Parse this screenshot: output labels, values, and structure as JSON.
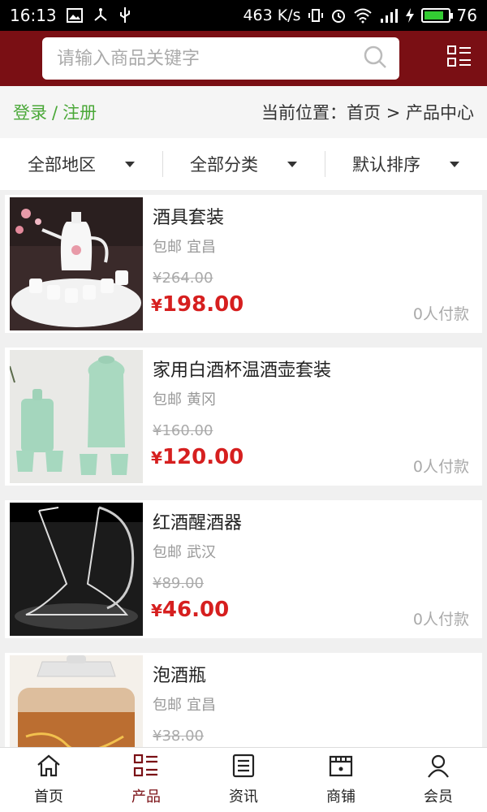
{
  "status_bar": {
    "time": "16:13",
    "net_speed": "463 K/s",
    "battery_level": "76"
  },
  "search": {
    "placeholder": "请输入商品关键字"
  },
  "breadcrumb": {
    "login": "登录",
    "separator": "/",
    "register": "注册",
    "location": "当前位置：首页 > 产品中心"
  },
  "filters": [
    {
      "label": "全部地区"
    },
    {
      "label": "全部分类"
    },
    {
      "label": "默认排序"
    }
  ],
  "products": [
    {
      "title": "酒具套装",
      "shipping": "包邮",
      "city": "宜昌",
      "orig_price": "¥264.00",
      "price": "198.00",
      "currency": "¥",
      "paid": "0人付款"
    },
    {
      "title": "家用白酒杯温酒壶套装",
      "shipping": "包邮",
      "city": "黄冈",
      "orig_price": "¥160.00",
      "price": "120.00",
      "currency": "¥",
      "paid": "0人付款"
    },
    {
      "title": "红酒醒酒器",
      "shipping": "包邮",
      "city": "武汉",
      "orig_price": "¥89.00",
      "price": "46.00",
      "currency": "¥",
      "paid": "0人付款"
    },
    {
      "title": "泡酒瓶",
      "shipping": "包邮",
      "city": "宜昌",
      "orig_price": "¥38.00",
      "price": "",
      "currency": "",
      "paid": ""
    }
  ],
  "tabs": [
    {
      "label": "首页",
      "icon": "home-icon"
    },
    {
      "label": "产品",
      "icon": "grid-list-icon",
      "active": true
    },
    {
      "label": "资讯",
      "icon": "news-icon"
    },
    {
      "label": "商铺",
      "icon": "store-icon"
    },
    {
      "label": "会员",
      "icon": "user-icon"
    }
  ],
  "colors": {
    "brand": "#7a0f14",
    "price": "#d61f1f",
    "login": "#4aa838"
  }
}
